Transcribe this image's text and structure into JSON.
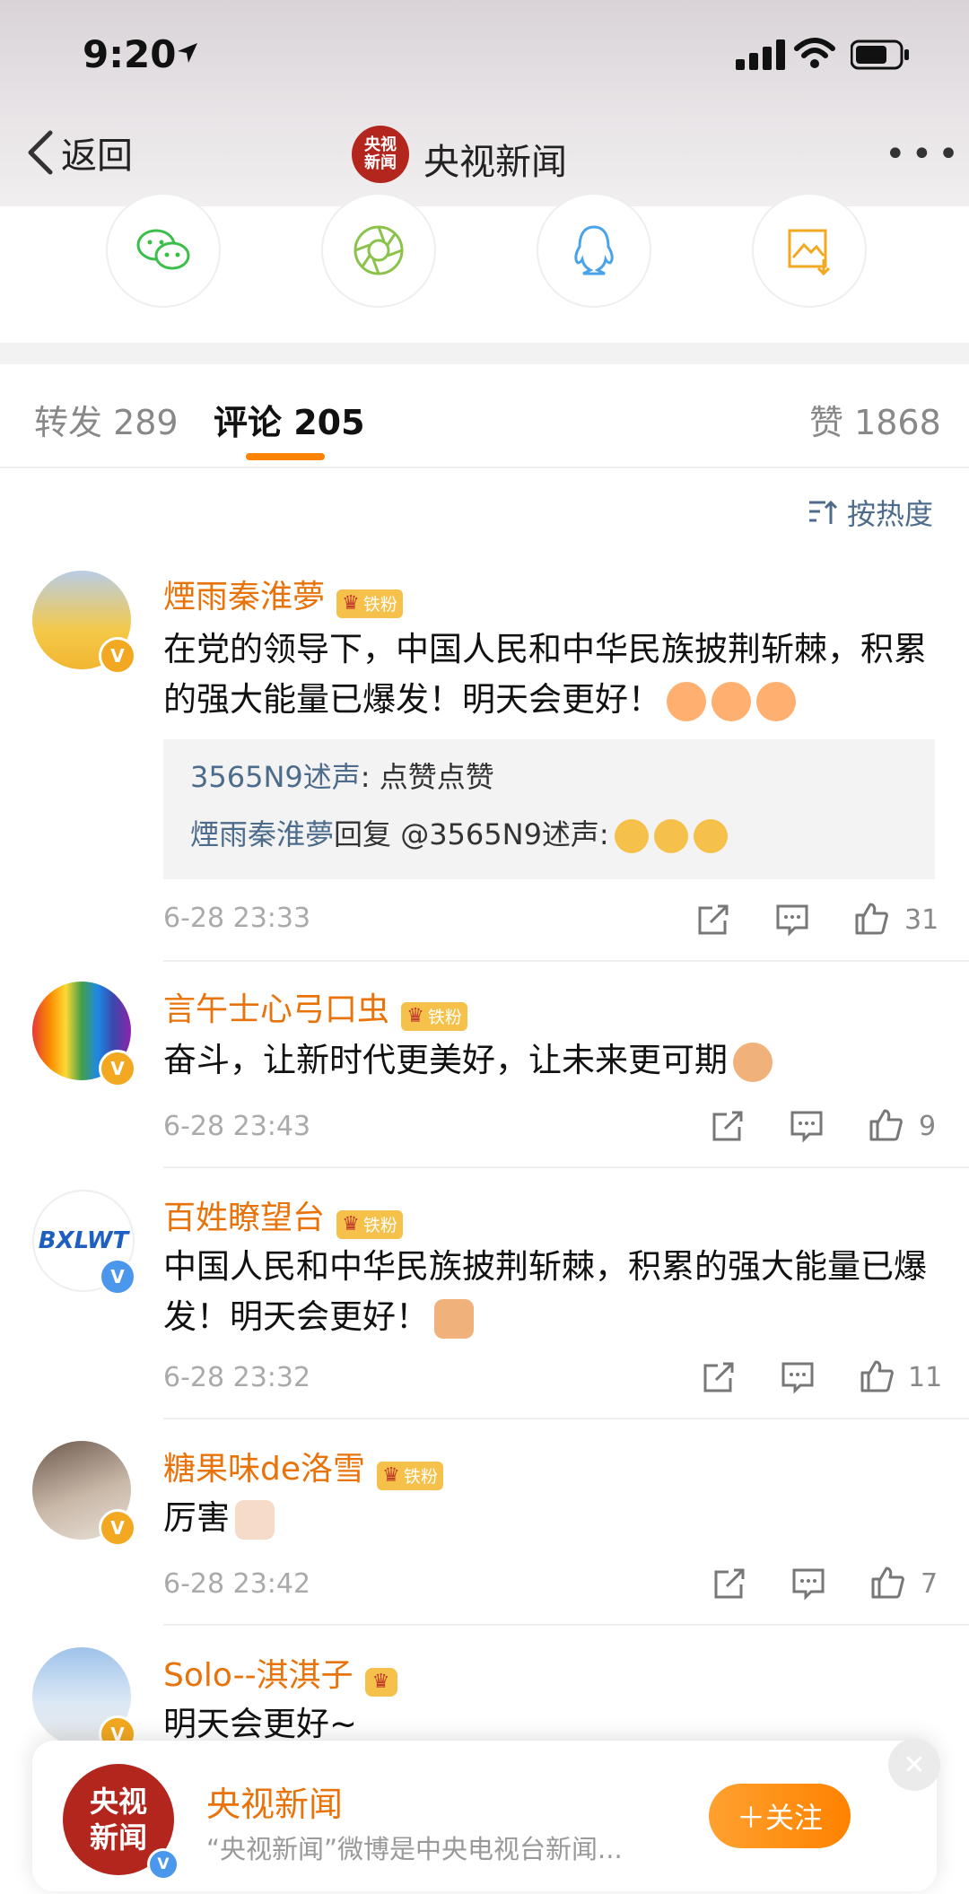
{
  "status_bar": {
    "time": "9:20"
  },
  "nav": {
    "back_label": "返回",
    "avatar_text": "央视\n新闻",
    "title": "央视新闻"
  },
  "tabs": {
    "repost": "转发 289",
    "comments": "评论 205",
    "likes": "赞 1868"
  },
  "sort": {
    "label": "按热度"
  },
  "comments": [
    {
      "name": "煙雨秦淮夢",
      "badge": "铁粉",
      "text": "在党的领导下，中国人民和中华民族披荆斩棘，积累的强大能量已爆发！明天会更好！",
      "replies": [
        {
          "name": "3565N9述声",
          "text": ": 点赞点赞"
        },
        {
          "name": "煙雨秦淮夢",
          "text": "回复 @3565N9述声:"
        }
      ],
      "time": "6-28 23:33",
      "likes": "31"
    },
    {
      "name": "言午士心弓口虫",
      "badge": "铁粉",
      "text": "奋斗，让新时代更美好，让未来更可期",
      "time": "6-28 23:43",
      "likes": "9"
    },
    {
      "name": "百姓瞭望台",
      "badge": "铁粉",
      "avatar_text": "BXLWT",
      "text": "中国人民和中华民族披荆斩棘，积累的强大能量已爆发！明天会更好！",
      "time": "6-28 23:32",
      "likes": "11"
    },
    {
      "name": "糖果味de洛雪",
      "badge": "铁粉",
      "text": "厉害",
      "time": "6-28 23:42",
      "likes": "7"
    },
    {
      "name": "Solo--淇淇子",
      "text": "明天会更好~"
    }
  ],
  "banner": {
    "avatar_text": "央视\n新闻",
    "name": "央视新闻",
    "desc": "“央视新闻”微博是中央电视台新闻...",
    "follow_label": "＋关注"
  },
  "colors": {
    "accent": "#ff8200",
    "username": "#e8730a",
    "link": "#4d6c8c"
  },
  "icons": [
    "location-arrow-icon",
    "signal-icon",
    "wifi-icon",
    "battery-icon",
    "back-chevron-icon",
    "more-dots-icon",
    "wechat-icon",
    "moments-icon",
    "qq-icon",
    "save-image-icon",
    "sort-icon",
    "share-icon",
    "comment-icon",
    "like-icon",
    "close-icon"
  ]
}
